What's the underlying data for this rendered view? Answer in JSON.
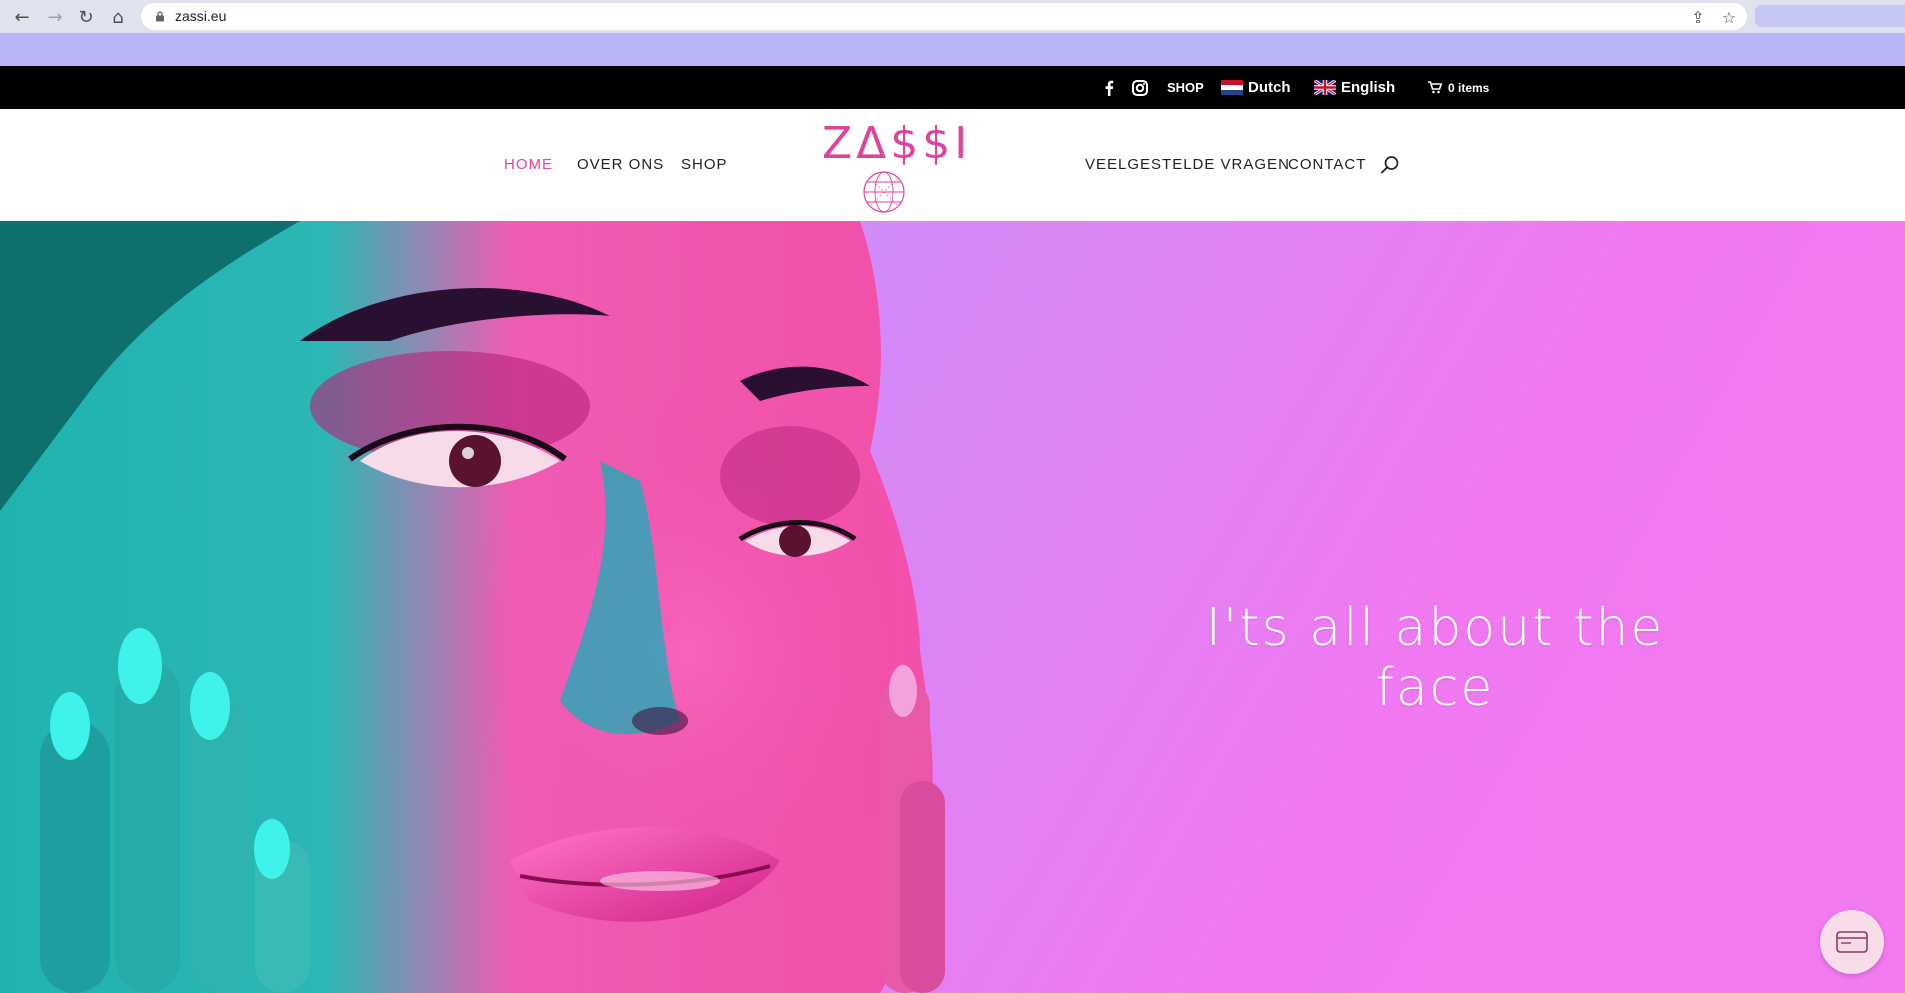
{
  "browser": {
    "url": "zassi.eu",
    "icons": [
      "back-icon",
      "forward-icon",
      "reload-icon",
      "home-icon",
      "lock-icon",
      "share-icon",
      "star-icon"
    ]
  },
  "top_bar": {
    "shop_label": "SHOP",
    "languages": [
      {
        "label": "Dutch",
        "flag": "netherlands-flag"
      },
      {
        "label": "English",
        "flag": "uk-flag"
      }
    ],
    "cart_label": "0 items"
  },
  "header": {
    "menu_left": [
      {
        "label": "HOME",
        "active": true
      },
      {
        "label": "OVER ONS",
        "active": false
      },
      {
        "label": "SHOP",
        "active": false
      }
    ],
    "logo_text": "ZΔ$$I",
    "menu_right": [
      {
        "label": "VEELGESTELDE VRAGEN"
      },
      {
        "label": "CONTACT"
      }
    ]
  },
  "hero": {
    "headline": "I'ts all about the face"
  },
  "colors": {
    "accent": "#e0439a",
    "top_bar": "#000000",
    "hero_pink": "#f37bf0",
    "hero_teal": "#1fb3b0"
  }
}
